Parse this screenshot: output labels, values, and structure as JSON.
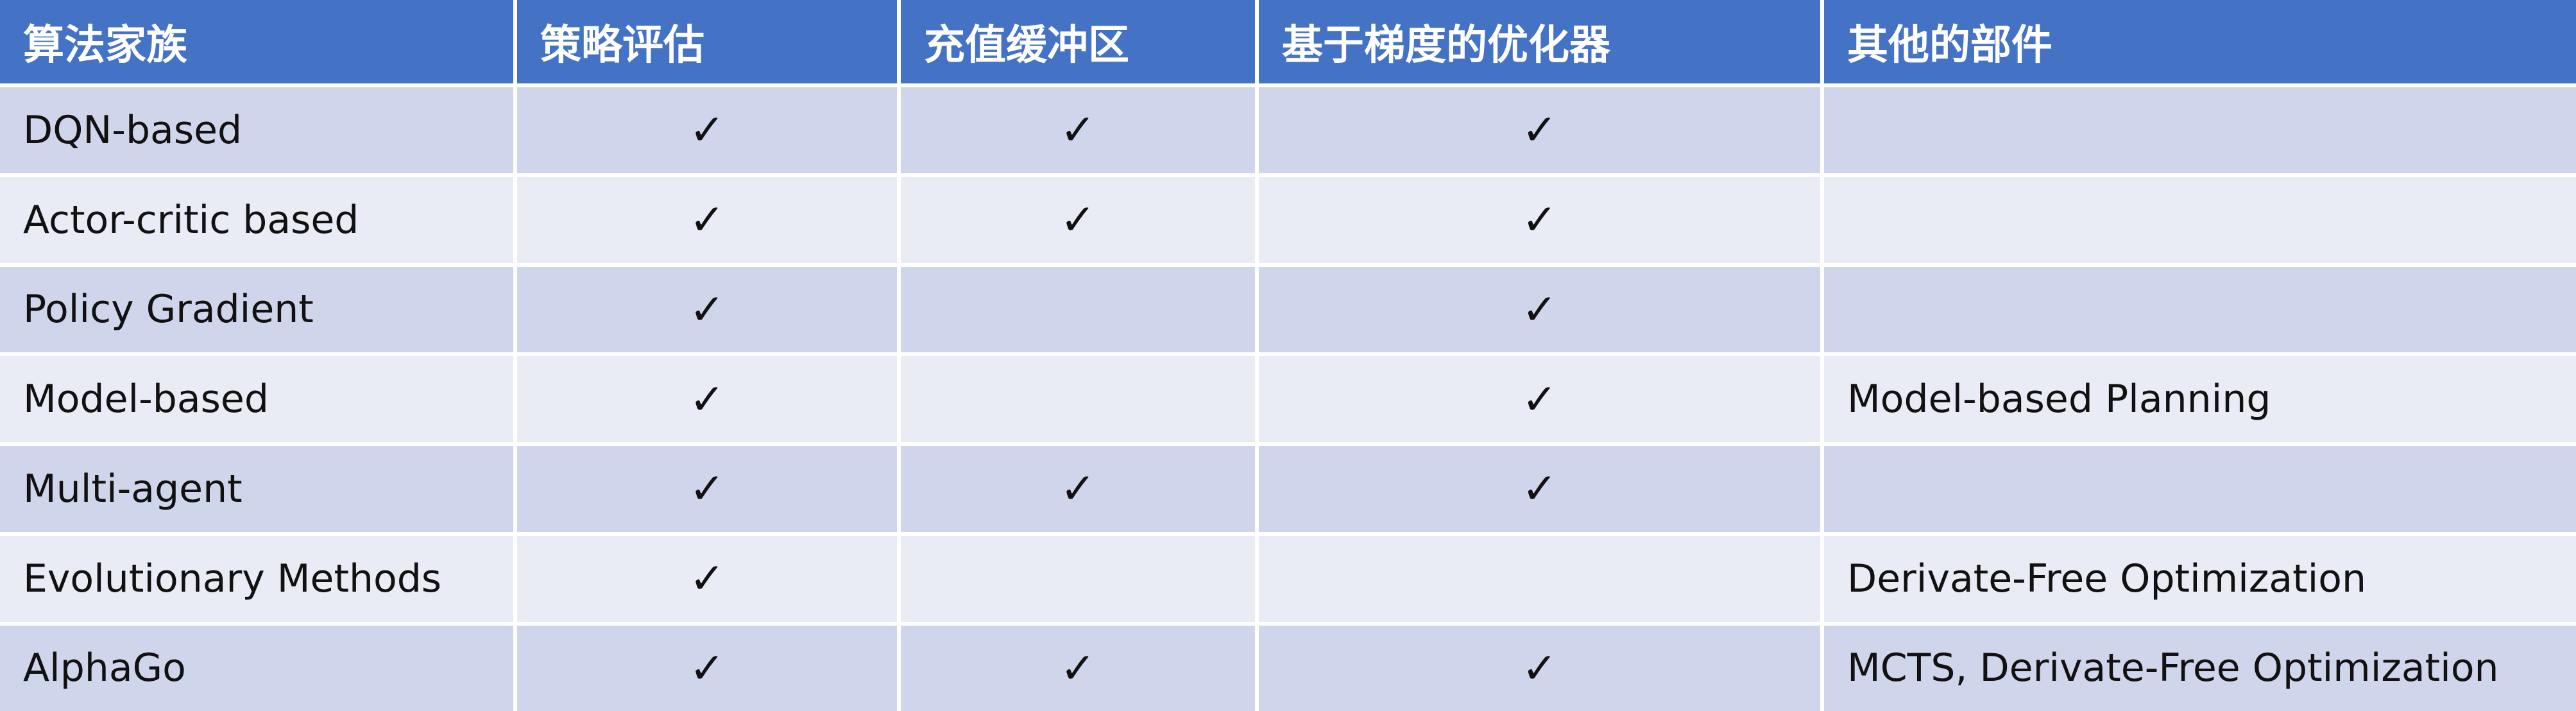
{
  "headers": [
    "算法家族",
    "策略评估",
    "充值缓冲区",
    "基于梯度的优化器",
    "其他的部件"
  ],
  "check_symbol": "✓",
  "rows": [
    {
      "family": "DQN-based",
      "policy_eval": true,
      "replay_buffer": true,
      "gradient_optimizer": true,
      "other": ""
    },
    {
      "family": "Actor-critic based",
      "policy_eval": true,
      "replay_buffer": true,
      "gradient_optimizer": true,
      "other": ""
    },
    {
      "family": "Policy Gradient",
      "policy_eval": true,
      "replay_buffer": false,
      "gradient_optimizer": true,
      "other": ""
    },
    {
      "family": "Model-based",
      "policy_eval": true,
      "replay_buffer": false,
      "gradient_optimizer": true,
      "other": "Model-based Planning"
    },
    {
      "family": "Multi-agent",
      "policy_eval": true,
      "replay_buffer": true,
      "gradient_optimizer": true,
      "other": ""
    },
    {
      "family": "Evolutionary Methods",
      "policy_eval": true,
      "replay_buffer": false,
      "gradient_optimizer": false,
      "other": "Derivate-Free Optimization"
    },
    {
      "family": "AlphaGo",
      "policy_eval": true,
      "replay_buffer": true,
      "gradient_optimizer": true,
      "other": "MCTS, Derivate-Free Optimization"
    }
  ],
  "colors": {
    "header_bg": "#4472c4",
    "header_text": "#ffffff",
    "row_odd_bg": "#cfd5ea",
    "row_even_bg": "#e9ebf5",
    "grid_line": "#ffffff"
  }
}
